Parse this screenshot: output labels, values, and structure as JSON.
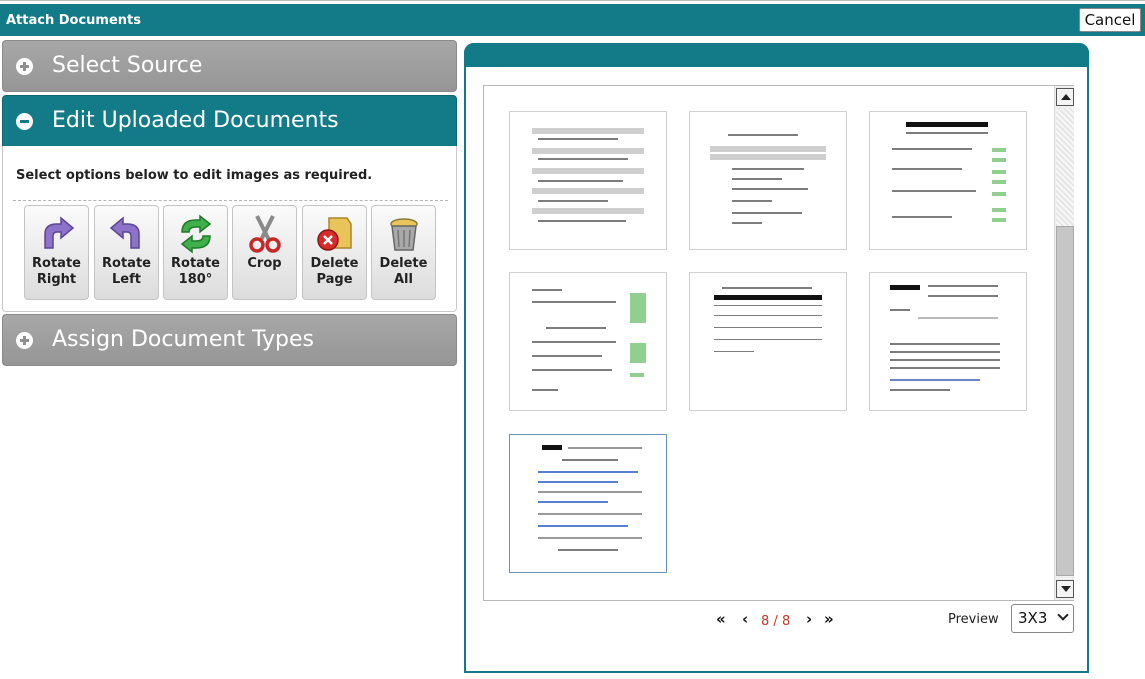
{
  "window": {
    "title": "Attach Documents",
    "cancel_label": "Cancel"
  },
  "accordion": {
    "select_source": "Select Source",
    "edit_uploaded": "Edit Uploaded Documents",
    "assign_types": "Assign Document Types"
  },
  "edit": {
    "hint": "Select options below to edit images as required.",
    "tools": [
      {
        "label": "Rotate\nRight",
        "icon": "rotate-right-icon"
      },
      {
        "label": "Rotate\nLeft",
        "icon": "rotate-left-icon"
      },
      {
        "label": "Rotate\n180°",
        "icon": "rotate-180-icon"
      },
      {
        "label": "Crop",
        "icon": "scissors-icon"
      },
      {
        "label": "Delete\nPage",
        "icon": "delete-page-icon"
      },
      {
        "label": "Delete\nAll",
        "icon": "trash-can-icon"
      }
    ]
  },
  "viewer": {
    "pages_total": 7,
    "selected_page": 7,
    "pager": {
      "current": "8",
      "separator": "/",
      "total": "8",
      "first_icon": "double-chevron-left-icon",
      "prev_icon": "chevron-left-icon",
      "next_icon": "chevron-right-icon",
      "last_icon": "double-chevron-right-icon"
    },
    "preview_label": "Preview",
    "preview_value": "3X3"
  },
  "colors": {
    "teal": "#137a88",
    "grey_header": "#9e9e9e",
    "page_count": "#c0392b"
  }
}
